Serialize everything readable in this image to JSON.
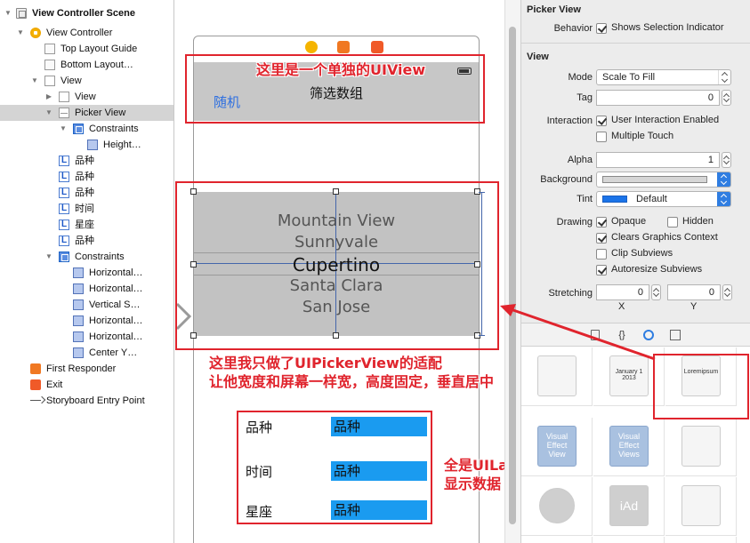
{
  "outline": {
    "items": [
      {
        "label": "View Controller Scene"
      },
      {
        "label": "View Controller"
      },
      {
        "label": "Top Layout Guide"
      },
      {
        "label": "Bottom Layout…"
      },
      {
        "label": "View"
      },
      {
        "label": "View"
      },
      {
        "label": "Picker View"
      },
      {
        "label": "Constraints"
      },
      {
        "label": "Height…"
      },
      {
        "label": "品种"
      },
      {
        "label": "品种"
      },
      {
        "label": "品种"
      },
      {
        "label": "时间"
      },
      {
        "label": "星座"
      },
      {
        "label": "品种"
      },
      {
        "label": "Constraints"
      },
      {
        "label": "Horizontal…"
      },
      {
        "label": "Horizontal…"
      },
      {
        "label": "Vertical S…"
      },
      {
        "label": "Horizontal…"
      },
      {
        "label": "Horizontal…"
      },
      {
        "label": "Center Y…"
      },
      {
        "label": "First Responder"
      },
      {
        "label": "Exit"
      },
      {
        "label": "Storyboard Entry Point"
      }
    ]
  },
  "canvas": {
    "top_view": {
      "title": "筛选数组",
      "button": "随机"
    },
    "picker_rows": [
      "Mountain View",
      "Sunnyvale",
      "Cupertino",
      "Santa Clara",
      "San Jose"
    ],
    "labels": [
      {
        "name": "品种",
        "value": "品种"
      },
      {
        "name": "时间",
        "value": "品种"
      },
      {
        "name": "星座",
        "value": "品种"
      }
    ]
  },
  "annotations": {
    "uiview": "这里是一个单独的UIView",
    "picker_line1": "这里我只做了UIPickerView的适配",
    "picker_line2": "让他宽度和屏幕一样宽，高度固定，垂直居中",
    "labels_line1": "全是UILabel",
    "labels_line2": "显示数据",
    "color": "#e0242d"
  },
  "inspector": {
    "picker_section": "Picker View",
    "behavior_label": "Behavior",
    "shows_selection": "Shows Selection Indicator",
    "view_section": "View",
    "mode_label": "Mode",
    "mode_value": "Scale To Fill",
    "tag_label": "Tag",
    "tag_value": "0",
    "interaction_label": "Interaction",
    "user_interaction": "User Interaction Enabled",
    "multiple_touch": "Multiple Touch",
    "alpha_label": "Alpha",
    "alpha_value": "1",
    "background_label": "Background",
    "tint_label": "Tint",
    "tint_value": "Default",
    "drawing_label": "Drawing",
    "opaque": "Opaque",
    "hidden": "Hidden",
    "clears_context": "Clears Graphics Context",
    "clip_subviews": "Clip Subviews",
    "autoresize": "Autoresize Subviews",
    "stretching_label": "Stretching",
    "stretch_x": "0",
    "stretch_y": "0",
    "x_label": "X",
    "y_label": "Y"
  },
  "library": {
    "tile_calendar": "January 1 2013",
    "tile_lorem": "Loremipsum",
    "tile_visual1": "Visual Effect View",
    "tile_visual2": "Visual Effect Views",
    "tile_iad": "iAd"
  }
}
